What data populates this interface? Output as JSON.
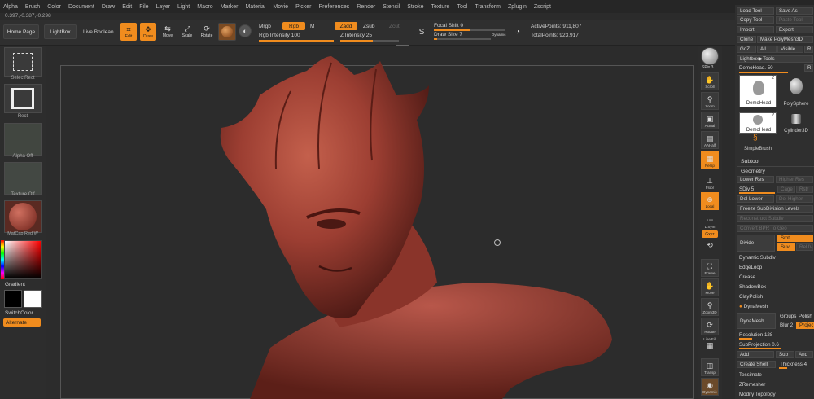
{
  "menu": [
    "Alpha",
    "Brush",
    "Color",
    "Document",
    "Draw",
    "Edit",
    "File",
    "Layer",
    "Light",
    "Macro",
    "Marker",
    "Material",
    "Movie",
    "Picker",
    "Preferences",
    "Render",
    "Stencil",
    "Stroke",
    "Texture",
    "Tool",
    "Transform",
    "Zplugin",
    "Zscript"
  ],
  "coords": "0.397,-0.387,-0.298",
  "toolbar": {
    "home_page": "Home Page",
    "lightbox": "LightBox",
    "live_boolean": "Live Boolean",
    "edit": "Edit",
    "draw": "Draw",
    "move": "Move",
    "scale": "Scale",
    "rotate": "Rotate",
    "mrgb": "Mrgb",
    "rgb": "Rgb",
    "m": "M",
    "zadd": "Zadd",
    "zsub": "Zsub",
    "zcut": "Zcut",
    "rgb_intensity": "Rgb Intensity 100",
    "rgb_intensity_value": 100,
    "z_intensity": "Z Intensity 25",
    "z_intensity_value": 25,
    "focal_shift": "Focal Shift 0",
    "draw_size": "Draw Size 7",
    "dynamic": "Dynamic",
    "active_points": "ActivePoints: 911,807",
    "total_points": "TotalPoints: 923,917"
  },
  "left": {
    "select_rect": "SelectRect",
    "rect": "Rect",
    "alpha_off": "Alpha Off",
    "texture_off": "Texture Off",
    "matcap": "MatCap Red W",
    "gradient": "Gradient",
    "switch_color": "SwitchColor",
    "alternate": "Alternate"
  },
  "right_shelf": {
    "spix": "SPix 3",
    "scroll": "Scroll",
    "zoom": "Zoom",
    "actual": "Actual",
    "aahalf": "AAHalf",
    "persp": "Persp",
    "floor": "Floor",
    "local": "Local",
    "lsym": "L.Sym",
    "gxyz": "Gxyz",
    "frame": "Frame",
    "move": "Move",
    "zoom3d": "Zoom3D",
    "rotate": "Rotate",
    "line_fill": "Line Fill",
    "polyf": "PolyF",
    "transp": "Transp",
    "dynamic": "Dynamic"
  },
  "tool": {
    "load_tool": "Load Tool",
    "save_as": "Save As",
    "copy_tool": "Copy Tool",
    "paste_tool": "Paste Tool",
    "import": "Import",
    "export": "Export",
    "clone": "Clone",
    "make_polymesh": "Make PolyMesh3D",
    "goz": "GoZ",
    "all": "All",
    "visible": "Visible",
    "r": "R",
    "lightbox_tools": "Lightbox▶Tools",
    "current": "DemoHead. 50",
    "current_r": "R",
    "items": [
      {
        "name": "DemoHead",
        "count": "2"
      },
      {
        "name": "PolySphere",
        "count": ""
      },
      {
        "name": "DemoHead",
        "count": "2"
      },
      {
        "name": "Cylinder3D",
        "count": ""
      },
      {
        "name": "SimpleBrush",
        "count": ""
      }
    ]
  },
  "subtool": {
    "title": "Subtool",
    "geometry": "Geometry",
    "lower_res": "Lower Res",
    "higher_res": "Higher Res",
    "sdiv": "SDiv 5",
    "cage": "Cage",
    "rstr": "Rstr",
    "del_lower": "Del Lower",
    "del_higher": "Del Higher",
    "freeze": "Freeze SubDivision Levels",
    "reconstruct": "Reconstruct Subdiv",
    "convert": "Convert BPR To Geo",
    "divide": "Divide",
    "smt": "Smt",
    "suv": "Suv",
    "reuv": "ReUV",
    "dynamic_subdiv": "Dynamic Subdiv",
    "edgeloop": "EdgeLoop",
    "crease": "Crease",
    "shadowbox": "ShadowBox",
    "claypolish": "ClayPolish",
    "dynamesh_title": "DynaMesh",
    "dynamesh": "DynaMesh",
    "groups": "Groups",
    "polish": "Polish",
    "blur": "Blur 2",
    "project": "Project",
    "resolution": "Resolution 128",
    "subprojection": "SubProjection 0.6",
    "add": "Add",
    "sub": "Sub",
    "and": "And",
    "create_shell": "Create Shell",
    "thickness": "Thickness 4",
    "tessimate": "Tessimate",
    "zremesher": "ZRemesher",
    "modify_topology": "Modify Topology"
  },
  "colors": {
    "accent": "#f08c1e",
    "sculpt": "#a8473a"
  }
}
